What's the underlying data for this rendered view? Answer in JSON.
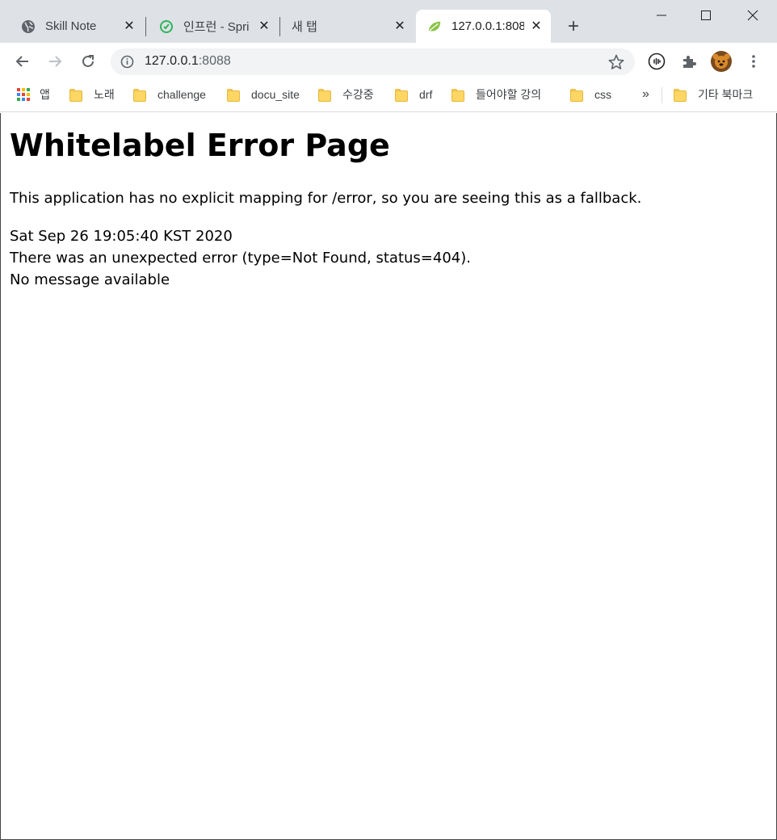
{
  "tabs": [
    {
      "title": "Skill Note",
      "icon": "globe-icon"
    },
    {
      "title": "인프런 - Spri",
      "icon": "inflearn-icon"
    },
    {
      "title": "새 탭",
      "icon": ""
    },
    {
      "title": "127.0.0.1:808",
      "icon": "spring-leaf-icon",
      "active": true
    }
  ],
  "new_tab_label": "+",
  "address": {
    "host": "127.0.0.1",
    "port": ":8088"
  },
  "bookmarks": {
    "apps_label": "앱",
    "items": [
      "노래",
      "challenge",
      "docu_site",
      "수강중",
      "drf",
      "들어야할 강의",
      "css"
    ],
    "overflow": "»",
    "other": "기타 북마크"
  },
  "page": {
    "heading": "Whitelabel Error Page",
    "description": "This application has no explicit mapping for /error, so you are seeing this as a fallback.",
    "timestamp": "Sat Sep 26 19:05:40 KST 2020",
    "error_line": "There was an unexpected error (type=Not Found, status=404).",
    "message": "No message available"
  },
  "colors": {
    "tabstrip": "#dee1e6",
    "omnibox": "#f1f3f4",
    "folder": "#fdd663"
  }
}
